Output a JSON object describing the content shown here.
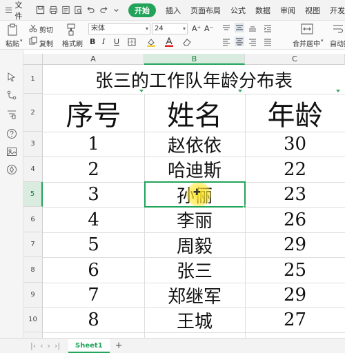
{
  "menubar": {
    "file_label": "文件",
    "tabs": [
      {
        "label": "开始",
        "active": true
      },
      {
        "label": "插入",
        "active": false
      },
      {
        "label": "页面布局",
        "active": false
      },
      {
        "label": "公式",
        "active": false
      },
      {
        "label": "数据",
        "active": false
      },
      {
        "label": "审阅",
        "active": false
      },
      {
        "label": "视图",
        "active": false
      },
      {
        "label": "开发",
        "active": false
      }
    ],
    "quick_icons": [
      "save-icon",
      "print-icon",
      "export-icon",
      "print-preview-icon",
      "undo-icon",
      "redo-icon",
      "dropdown-icon"
    ]
  },
  "ribbon": {
    "paste_label": "粘贴",
    "cut_label": "剪切",
    "copy_label": "复制",
    "format_painter_label": "格式刷",
    "font_name": "宋体",
    "font_size": "24",
    "bold": "B",
    "italic": "I",
    "underline": "U",
    "merge_label": "合并居中",
    "autowrap_label": "自动换",
    "increase_font": "A⁺",
    "decrease_font": "A⁻"
  },
  "sheet": {
    "columns": [
      "A",
      "B",
      "C"
    ],
    "selected_column": "B",
    "selected_row": "5",
    "rows": [
      {
        "num": "1",
        "merged": "张三的工作队年龄分布表"
      },
      {
        "num": "2",
        "cells": [
          "序号",
          "姓名",
          "年龄"
        ]
      },
      {
        "num": "3",
        "cells": [
          "1",
          "赵依依",
          "30"
        ]
      },
      {
        "num": "4",
        "cells": [
          "2",
          "哈迪斯",
          "22"
        ]
      },
      {
        "num": "5",
        "cells": [
          "3",
          "孙俪",
          "23"
        ]
      },
      {
        "num": "6",
        "cells": [
          "4",
          "李丽",
          "26"
        ]
      },
      {
        "num": "7",
        "cells": [
          "5",
          "周毅",
          "29"
        ]
      },
      {
        "num": "8",
        "cells": [
          "6",
          "张三",
          "25"
        ]
      },
      {
        "num": "9",
        "cells": [
          "7",
          "郑继军",
          "29"
        ]
      },
      {
        "num": "10",
        "cells": [
          "8",
          "王城",
          "27"
        ]
      }
    ]
  },
  "bottombar": {
    "sheet_tab": "Sheet1",
    "add_label": "+"
  },
  "colors": {
    "accent": "#22a35a",
    "cursor_highlight": "#ffe628"
  }
}
